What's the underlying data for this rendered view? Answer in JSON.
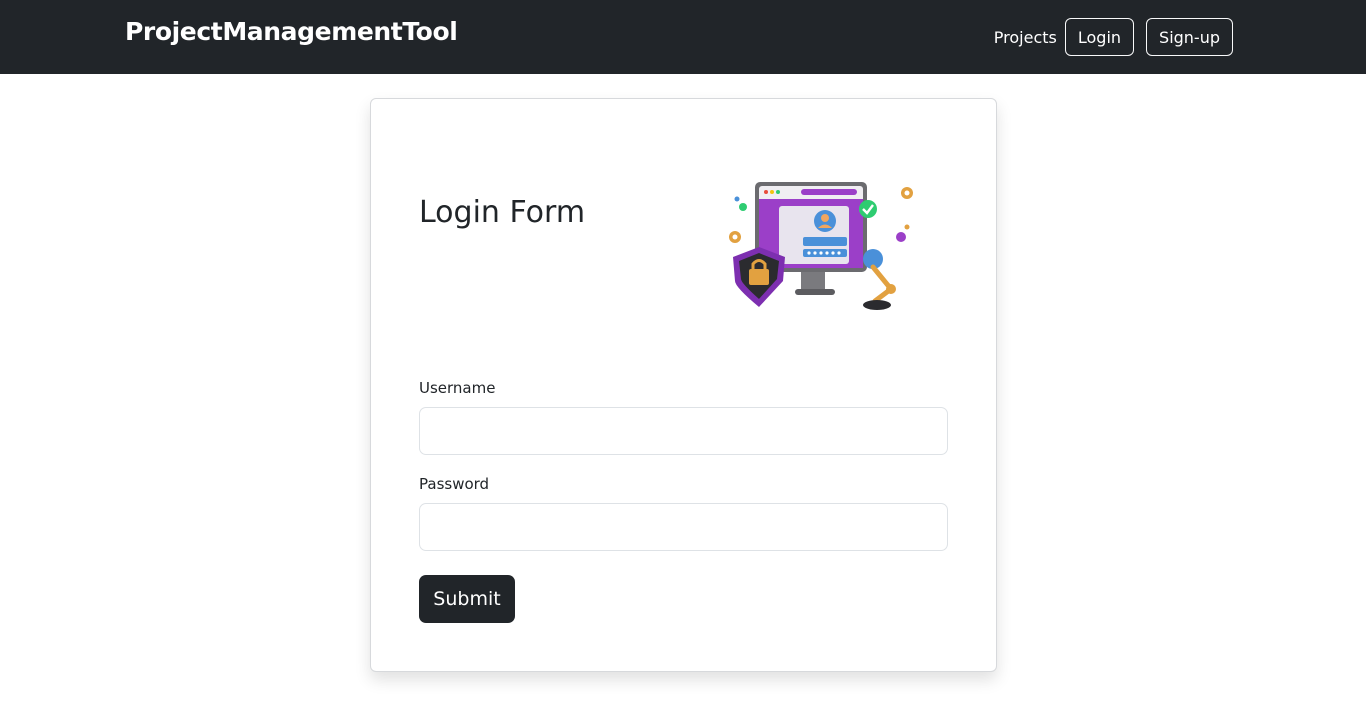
{
  "navbar": {
    "brand": "ProjectManagementTool",
    "links": {
      "projects": "Projects",
      "login": "Login",
      "signup": "Sign-up"
    }
  },
  "login_form": {
    "title": "Login Form",
    "illustration": {
      "icon": "login-computer-illustration",
      "screen_text": "username"
    },
    "username": {
      "label": "Username",
      "value": "",
      "placeholder": ""
    },
    "password": {
      "label": "Password",
      "value": "",
      "placeholder": ""
    },
    "submit_label": "Submit"
  },
  "colors": {
    "navbar_bg": "#212529",
    "button_dark": "#212529",
    "illustration_purple": "#9b3fc8"
  }
}
